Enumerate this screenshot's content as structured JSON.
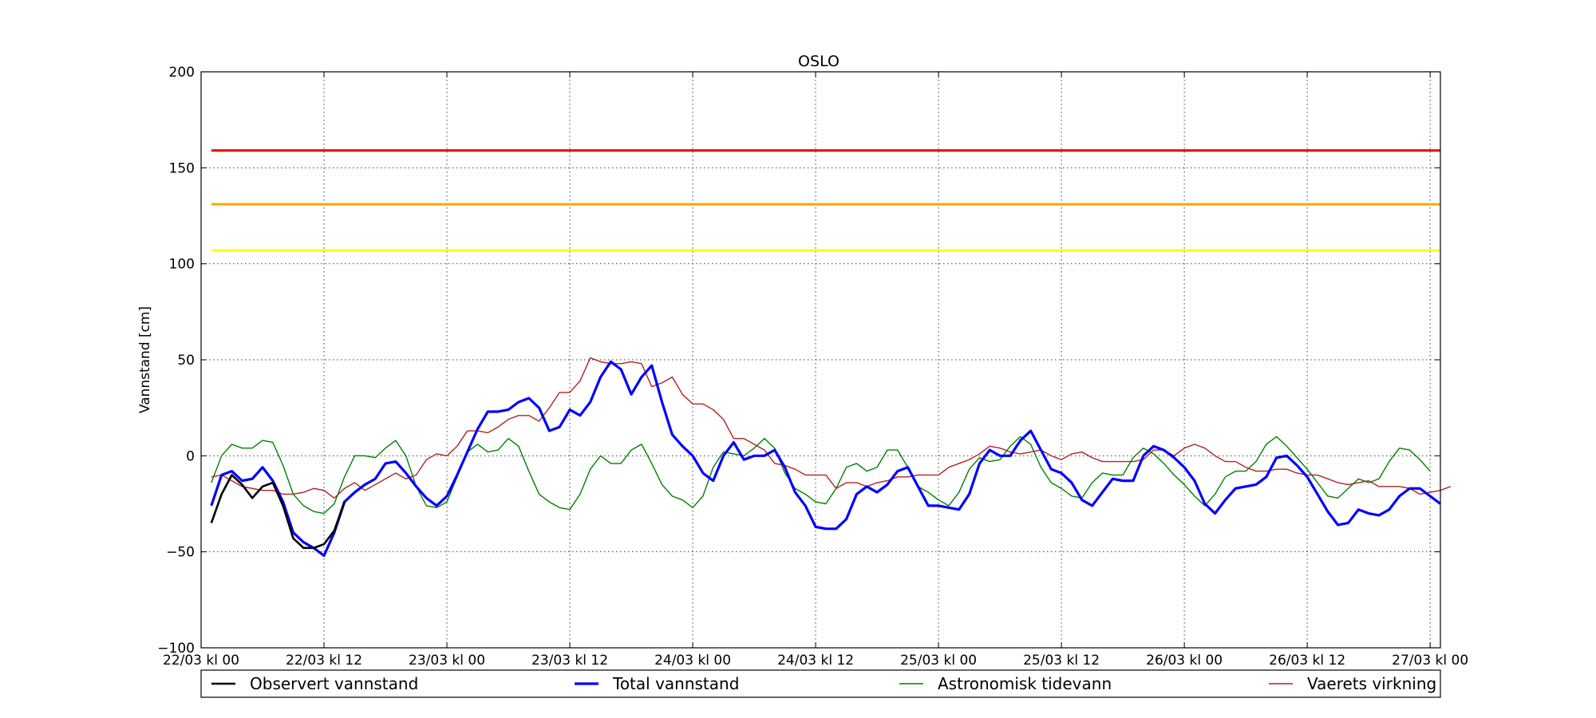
{
  "chart_data": {
    "type": "line",
    "title": "OSLO",
    "xlabel": "",
    "ylabel": "Vannstand [cm]",
    "ylim": [
      -100,
      200
    ],
    "xlim": [
      0,
      121
    ],
    "x_ticks": [
      {
        "x": 0,
        "label": "22/03 kl 00"
      },
      {
        "x": 12,
        "label": "22/03 kl 12"
      },
      {
        "x": 24,
        "label": "23/03 kl 00"
      },
      {
        "x": 36,
        "label": "23/03 kl 12"
      },
      {
        "x": 48,
        "label": "24/03 kl 00"
      },
      {
        "x": 60,
        "label": "24/03 kl 12"
      },
      {
        "x": 72,
        "label": "25/03 kl 00"
      },
      {
        "x": 84,
        "label": "25/03 kl 12"
      },
      {
        "x": 96,
        "label": "26/03 kl 00"
      },
      {
        "x": 108,
        "label": "26/03 kl 12"
      },
      {
        "x": 120,
        "label": "27/03 kl 00"
      }
    ],
    "y_ticks": [
      -100,
      -50,
      0,
      50,
      100,
      150,
      200
    ],
    "grid": true,
    "legend": "bottom",
    "thresholds": [
      {
        "value": 159,
        "color": "#ee0000"
      },
      {
        "value": 131,
        "color": "#ffa500"
      },
      {
        "value": 107,
        "color": "#ffff00"
      }
    ],
    "series": [
      {
        "name": "Observert vannstand",
        "color": "#000000",
        "width": 2.6,
        "start": 1,
        "values": [
          -35,
          -20,
          -10,
          -15,
          -22,
          -16,
          -14,
          -26,
          -43,
          -48,
          -48,
          -46,
          -39,
          -24
        ]
      },
      {
        "name": "Total vannstand",
        "color": "#0000ff",
        "width": 3.2,
        "start": 1,
        "values": [
          -26,
          -10,
          -8,
          -13,
          -12,
          -6,
          -13,
          -24,
          -40,
          -45,
          -48,
          -52,
          -40,
          -24,
          -19,
          -15,
          -12,
          -4,
          -3,
          -9,
          -16,
          -22,
          -26,
          -21,
          -10,
          2,
          14,
          23,
          23,
          24,
          28,
          30,
          25,
          13,
          15,
          24,
          21,
          28,
          41,
          49,
          45,
          32,
          41,
          47,
          28,
          11,
          5,
          0,
          -9,
          -13,
          0,
          7,
          -2,
          0,
          0,
          3,
          -6,
          -19,
          -26,
          -37,
          -38,
          -38,
          -33,
          -20,
          -16,
          -19,
          -15,
          -8,
          -6,
          -16,
          -26,
          -26,
          -27,
          -28,
          -20,
          -4,
          3,
          0,
          0,
          8,
          13,
          3,
          -7,
          -9,
          -14,
          -23,
          -26,
          -19,
          -12,
          -13,
          -13,
          0,
          5,
          3,
          -1,
          -6,
          -13,
          -25,
          -30,
          -23,
          -17,
          -16,
          -15,
          -11,
          -1,
          0,
          -5,
          -11,
          -20,
          -29,
          -36,
          -35,
          -28,
          -30,
          -31,
          -28,
          -21,
          -17,
          -17,
          -21,
          -25
        ]
      },
      {
        "name": "Astronomisk tidevann",
        "color": "#008000",
        "width": 1.4,
        "start": 1,
        "values": [
          -14,
          0,
          6,
          4,
          4,
          8,
          7,
          -5,
          -20,
          -26,
          -29,
          -30,
          -25,
          -11,
          0,
          0,
          -1,
          4,
          8,
          0,
          -16,
          -26,
          -27,
          -24,
          -11,
          2,
          6,
          2,
          3,
          9,
          5,
          -8,
          -20,
          -24,
          -27,
          -28,
          -20,
          -7,
          0,
          -4,
          -4,
          3,
          6,
          -4,
          -15,
          -21,
          -23,
          -27,
          -21,
          -6,
          2,
          1,
          0,
          4,
          9,
          4,
          -9,
          -17,
          -20,
          -24,
          -25,
          -17,
          -6,
          -4,
          -8,
          -6,
          3,
          3,
          -6,
          -16,
          -19,
          -23,
          -26,
          -19,
          -7,
          -1,
          -3,
          -2,
          5,
          10,
          6,
          -6,
          -14,
          -17,
          -21,
          -22,
          -14,
          -9,
          -10,
          -10,
          -1,
          4,
          1,
          -4,
          -10,
          -15,
          -21,
          -26,
          -20,
          -11,
          -8,
          -8,
          -3,
          6,
          10,
          5,
          -1,
          -7,
          -14,
          -21,
          -22,
          -17,
          -12,
          -14,
          -12,
          -3,
          4,
          3,
          -2,
          -8
        ]
      },
      {
        "name": "Vaerets virkning",
        "color": "#b22222",
        "width": 1.4,
        "start": 1,
        "values": [
          -11,
          -10,
          -13,
          -16,
          -17,
          -18,
          -18,
          -20,
          -20,
          -19,
          -17,
          -18,
          -22,
          -17,
          -14,
          -18,
          -15,
          -12,
          -9,
          -12,
          -10,
          -2,
          1,
          0,
          5,
          13,
          13,
          12,
          15,
          19,
          21,
          21,
          18,
          25,
          33,
          33,
          39,
          51,
          49,
          48,
          48,
          49,
          48,
          36,
          38,
          41,
          32,
          27,
          27,
          24,
          19,
          9,
          9,
          6,
          3,
          -4,
          -5,
          -7,
          -10,
          -10,
          -10,
          -17,
          -14,
          -14,
          -16,
          -14,
          -13,
          -11,
          -11,
          -10,
          -10,
          -10,
          -6,
          -4,
          -2,
          1,
          5,
          4,
          2,
          1,
          2,
          3,
          0,
          -2,
          1,
          2,
          -1,
          -3,
          -3,
          -3,
          -3,
          -2,
          3,
          3,
          0,
          4,
          6,
          4,
          0,
          -3,
          -3,
          -6,
          -8,
          -8,
          -7,
          -7,
          -9,
          -10,
          -10,
          -12,
          -14,
          -15,
          -14,
          -13,
          -16,
          -16,
          -16,
          -17,
          -20,
          -19,
          -18,
          -16
        ]
      }
    ]
  }
}
